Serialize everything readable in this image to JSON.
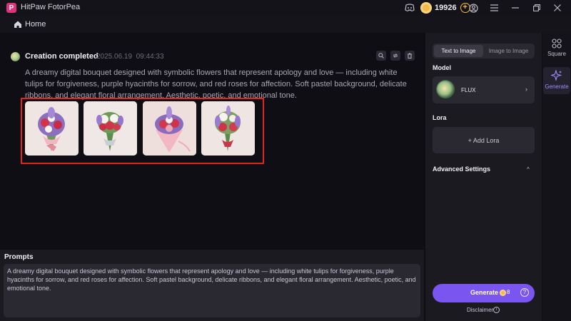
{
  "app": {
    "title": "HitPaw FotorPea",
    "logo_letter": "P",
    "credits": "19926"
  },
  "nav": {
    "home_label": "Home"
  },
  "result": {
    "status_title": "Creation completed",
    "date": "2025.06.19",
    "time": "09:44:33",
    "prompt": "A dreamy digital bouquet designed with symbolic flowers that represent apology and love — including white tulips for forgiveness, purple hyacinths for sorrow, and red roses for affection. Soft pastel background, delicate ribbons, and elegant floral arrangement. Aesthetic, poetic, and emotional tone."
  },
  "prompts": {
    "title": "Prompts",
    "text": "A dreamy digital bouquet designed with symbolic flowers that represent apology and love — including white tulips for forgiveness, purple hyacinths for sorrow, and red roses for affection. Soft pastel background, delicate ribbons, and elegant floral arrangement. Aesthetic, poetic, and emotional tone."
  },
  "panel": {
    "tabs": [
      {
        "label": "Text to Image",
        "active": true
      },
      {
        "label": "Image to Image",
        "active": false
      }
    ],
    "model_label": "Model",
    "model_name": "FLUX",
    "lora_label": "Lora",
    "add_lora": "+ Add Lora",
    "advanced_label": "Advanced Settings",
    "generate_label": "Generate",
    "generate_cost": "8",
    "disclaimer": "Disclaimer"
  },
  "rail": [
    {
      "label": "Square",
      "icon": "grid-icon",
      "active": false
    },
    {
      "label": "Generate",
      "icon": "sparkle-icon",
      "active": true
    }
  ],
  "colors": {
    "accent": "#7a55f0",
    "highlight_frame": "#e5231f",
    "coin": "#f5b94b"
  }
}
